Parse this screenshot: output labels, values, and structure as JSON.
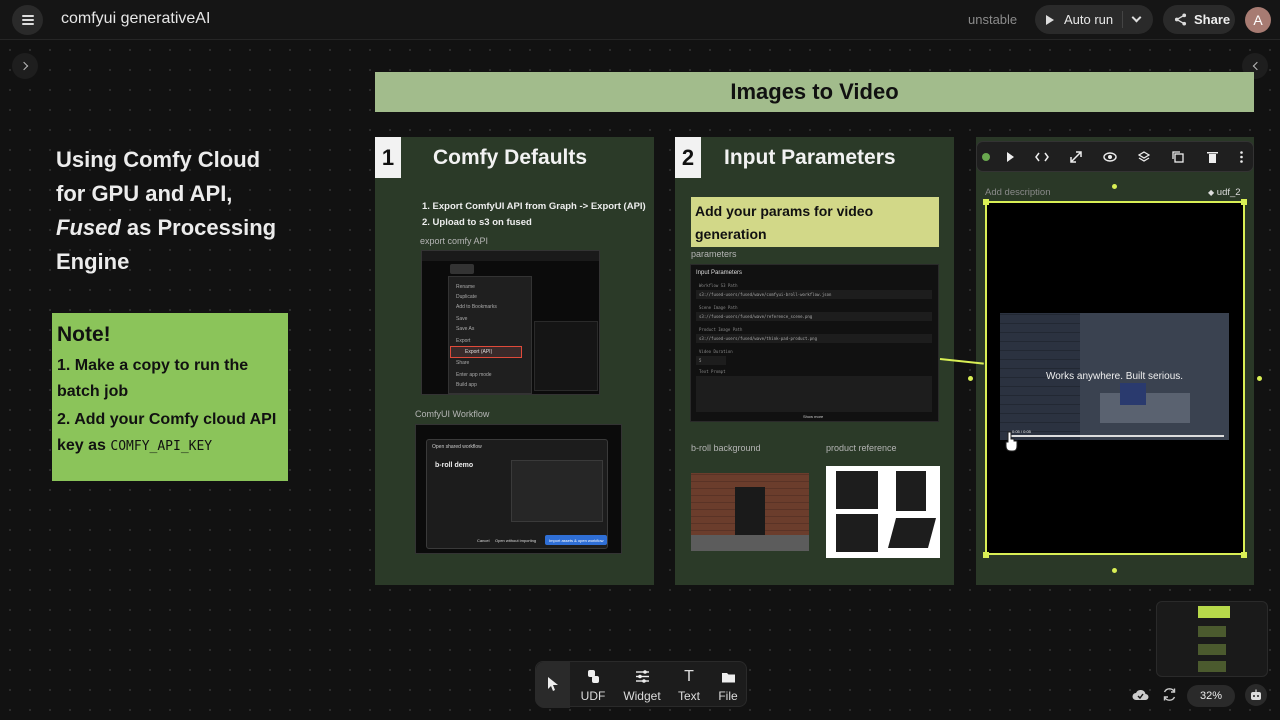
{
  "header": {
    "menu_icon": "hamburger-icon",
    "title": "comfyui generativeAI",
    "status": "unstable",
    "autorun_label": "Auto run",
    "share_label": "Share",
    "avatar_initial": "A"
  },
  "canvas": {
    "left_heading": {
      "line1": "Using Comfy Cloud",
      "line2": "for GPU and API,",
      "line3_em": "Fused",
      "line3_rest": " as Processing",
      "line4": "Engine"
    },
    "note": {
      "title": "Note!",
      "line1": "1. Make a copy to run the batch job",
      "line2_text": "2. Add your Comfy cloud API key as ",
      "line2_code": "COMFY_API_KEY"
    },
    "banner_title": "Images to Video",
    "panel1": {
      "number": "1",
      "title": "Comfy Defaults",
      "step1": "1. Export ComfyUI API from Graph -> Export (API)",
      "step2": "2. Upload to s3 on fused",
      "label_export": "export comfy API",
      "label_workflow": "ComfyUI Workflow",
      "menu_items": [
        "Rename",
        "Duplicate",
        "Add to Bookmarks",
        "Save",
        "Save As",
        "Export",
        "Export (API)",
        "Share",
        "Enter app mode",
        "Build app"
      ],
      "dialog_title": "Open shared workflow",
      "dialog_heading": "b-roll demo",
      "dialog_cancel": "Cancel",
      "dialog_open": "Open without importing",
      "dialog_import": "Import assets & open workflow"
    },
    "panel2": {
      "number": "2",
      "title": "Input Parameters",
      "callout": "Add your params for video generation",
      "label_parameters": "parameters",
      "params_header": "Input Parameters",
      "params": [
        {
          "label": "Workflow S3 Path",
          "value": "s3://fused-users/fused/wave/comfyui-broll-workflow.json"
        },
        {
          "label": "Scene Image Path",
          "value": "s3://fused-users/fused/wave/reference_scene.png"
        },
        {
          "label": "Product Image Path",
          "value": "s3://fused-users/fused/wave/think-pad-product.png"
        },
        {
          "label": "Video Duration",
          "value": "5"
        }
      ],
      "text_prompt_label": "Text Prompt",
      "show_more": "Show more",
      "label_broll": "b-roll background",
      "label_product": "product reference"
    },
    "panel3": {
      "description_placeholder": "Add description",
      "udf_name": "udf_2",
      "video_caption": "Works anywhere. Built serious.",
      "video_time": "0:05 / 0:05"
    }
  },
  "node_toolbar": {
    "icons": [
      "status-dot-icon",
      "play-icon",
      "code-icon",
      "expand-icon",
      "eye-icon",
      "layers-icon",
      "copy-icon",
      "trash-icon",
      "more-icon"
    ]
  },
  "bottom_toolbar": {
    "tools": [
      {
        "name": "select",
        "label": ""
      },
      {
        "name": "udf",
        "label": "UDF"
      },
      {
        "name": "widget",
        "label": "Widget"
      },
      {
        "name": "text",
        "label": "Text"
      },
      {
        "name": "file",
        "label": "File"
      }
    ]
  },
  "zoom": "32%",
  "colors": {
    "accent_lime": "#d9ef55",
    "note_green": "#8bc45a",
    "banner_green": "#a2bc8c",
    "panel_green": "#2b3a28",
    "callout_yellow": "#d2d888"
  }
}
